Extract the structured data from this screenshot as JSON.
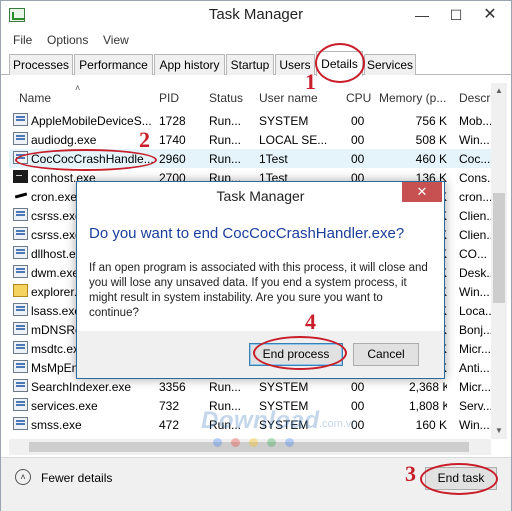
{
  "window": {
    "title": "Task Manager",
    "min_glyph": "—",
    "max_glyph": "☐",
    "close_glyph": "✕"
  },
  "menu": [
    "File",
    "Options",
    "View"
  ],
  "tabs": [
    "Processes",
    "Performance",
    "App history",
    "Startup",
    "Users",
    "Details",
    "Services"
  ],
  "active_tab": "Details",
  "columns": [
    "Name",
    "PID",
    "Status",
    "User name",
    "CPU",
    "Memory (p...",
    "Descr"
  ],
  "rows": [
    {
      "name": "AppleMobileDeviceS...",
      "pid": "1728",
      "status": "Run...",
      "user": "SYSTEM",
      "cpu": "00",
      "mem": "756 K",
      "desc": "Mob...",
      "icon": "generic"
    },
    {
      "name": "audiodg.exe",
      "pid": "1740",
      "status": "Run...",
      "user": "LOCAL SE...",
      "cpu": "00",
      "mem": "508 K",
      "desc": "Win...",
      "icon": "generic"
    },
    {
      "name": "CocCocCrashHandle...",
      "pid": "2960",
      "status": "Run...",
      "user": "1Test",
      "cpu": "00",
      "mem": "460 K",
      "desc": "Coc...",
      "icon": "generic",
      "selected": true
    },
    {
      "name": "conhost.exe",
      "pid": "2700",
      "status": "Run...",
      "user": "1Test",
      "cpu": "00",
      "mem": "136 K",
      "desc": "Cons...",
      "icon": "console"
    },
    {
      "name": "cron.exe",
      "pid": "",
      "status": "",
      "user": "",
      "cpu": "",
      "mem": "K",
      "desc": "cron...",
      "icon": "cron"
    },
    {
      "name": "csrss.exe",
      "pid": "",
      "status": "",
      "user": "",
      "cpu": "",
      "mem": "K",
      "desc": "Clien...",
      "icon": "generic"
    },
    {
      "name": "csrss.exe",
      "pid": "",
      "status": "",
      "user": "",
      "cpu": "",
      "mem": "K",
      "desc": "Clien...",
      "icon": "generic"
    },
    {
      "name": "dllhost.exe",
      "pid": "",
      "status": "",
      "user": "",
      "cpu": "",
      "mem": "K",
      "desc": "CO...",
      "icon": "generic"
    },
    {
      "name": "dwm.exe",
      "pid": "",
      "status": "",
      "user": "",
      "cpu": "",
      "mem": "K",
      "desc": "Desk...",
      "icon": "generic"
    },
    {
      "name": "explorer.exe",
      "pid": "",
      "status": "",
      "user": "",
      "cpu": "",
      "mem": "K",
      "desc": "Win...",
      "icon": "folder"
    },
    {
      "name": "lsass.exe",
      "pid": "",
      "status": "",
      "user": "",
      "cpu": "",
      "mem": "K",
      "desc": "Loca...",
      "icon": "generic"
    },
    {
      "name": "mDNSResponder.exe",
      "pid": "",
      "status": "",
      "user": "",
      "cpu": "",
      "mem": "K",
      "desc": "Bonj...",
      "icon": "generic"
    },
    {
      "name": "msdtc.exe",
      "pid": "",
      "status": "",
      "user": "",
      "cpu": "",
      "mem": "K",
      "desc": "Micr...",
      "icon": "generic"
    },
    {
      "name": "MsMpEng.exe",
      "pid": "",
      "status": "",
      "user": "",
      "cpu": "",
      "mem": "K",
      "desc": "Anti...",
      "icon": "generic"
    },
    {
      "name": "SearchIndexer.exe",
      "pid": "3356",
      "status": "Run...",
      "user": "SYSTEM",
      "cpu": "00",
      "mem": "2,368 K",
      "desc": "Micr...",
      "icon": "generic"
    },
    {
      "name": "services.exe",
      "pid": "732",
      "status": "Run...",
      "user": "SYSTEM",
      "cpu": "00",
      "mem": "1,808 K",
      "desc": "Serv...",
      "icon": "generic"
    },
    {
      "name": "smss.exe",
      "pid": "472",
      "status": "Run...",
      "user": "SYSTEM",
      "cpu": "00",
      "mem": "160 K",
      "desc": "Win...",
      "icon": "generic"
    }
  ],
  "footer": {
    "fewer_details": "Fewer details",
    "fewer_icon": "˄",
    "end_task": "End task"
  },
  "dialog": {
    "title": "Task Manager",
    "close_glyph": "✕",
    "question": "Do you want to end CocCocCrashHandler.exe?",
    "body": "If an open program is associated with this process, it will close and you will lose any unsaved data. If you end a system process, it might result in system instability. Are you sure you want to continue?",
    "end_process": "End process",
    "cancel": "Cancel"
  },
  "annotations": [
    "1",
    "2",
    "3",
    "4"
  ],
  "watermark": {
    "text": "Download",
    "suffix": ".com.vn"
  },
  "colors": {
    "annotation_red": "#c81e2a",
    "question_blue": "#1b3e9b",
    "selection": "#e5f3fb",
    "dialog_close": "#c75050"
  },
  "icons": {
    "sort": "sort-up-icon",
    "scroll_up": "scroll-up-icon",
    "scroll_down": "scroll-down-icon"
  }
}
